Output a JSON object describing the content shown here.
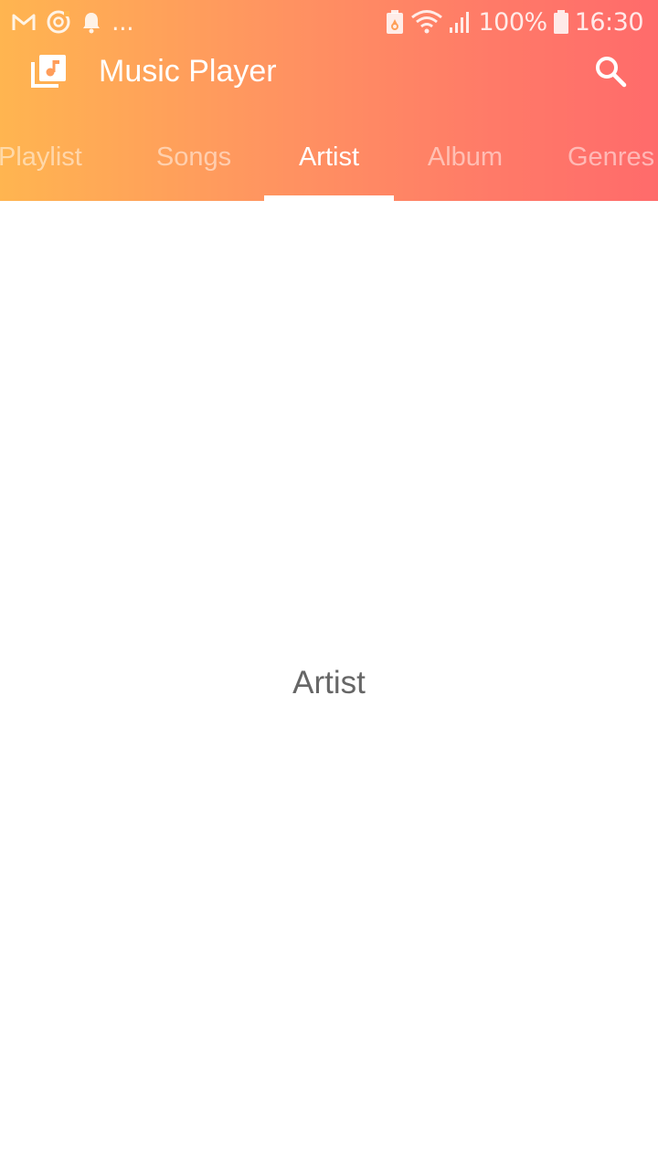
{
  "status_bar": {
    "overflow_dots": "...",
    "battery_percent": "100%",
    "time": "16:30",
    "icons": [
      "gmail-icon",
      "sync-icon",
      "notification-bell-icon",
      "battery-saver-icon",
      "wifi-icon",
      "signal-icon",
      "battery-icon"
    ]
  },
  "toolbar": {
    "app_icon": "music-library-icon",
    "title": "Music Player",
    "search_icon": "search-icon"
  },
  "tabs": [
    {
      "label": "Playlist",
      "active": false
    },
    {
      "label": "Songs",
      "active": false
    },
    {
      "label": "Artist",
      "active": true
    },
    {
      "label": "Album",
      "active": false
    },
    {
      "label": "Genres",
      "active": false
    }
  ],
  "content": {
    "label": "Artist"
  },
  "colors": {
    "gradient_start": "#FFB550",
    "gradient_end": "#FF6B6B",
    "text_secondary": "#666666"
  }
}
